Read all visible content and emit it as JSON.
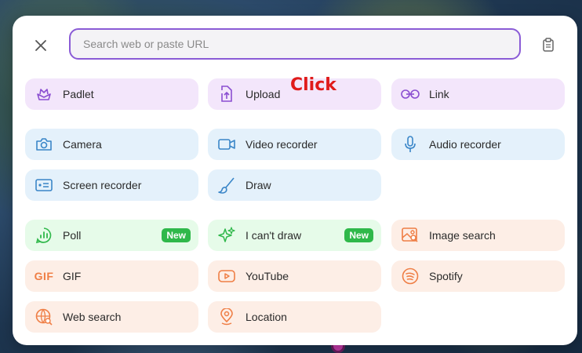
{
  "search": {
    "placeholder": "Search web or paste URL"
  },
  "annotation": "Click",
  "colors": {
    "accent": "#8a5bd6",
    "purple_icon": "#8b4fd1",
    "blue_icon": "#3a86c8",
    "green_icon": "#2fb84a",
    "orange_icon": "#ef7e45"
  },
  "tiles": [
    {
      "label": "Padlet",
      "icon": "padlet-icon"
    },
    {
      "label": "Upload",
      "icon": "upload-icon"
    },
    {
      "label": "Link",
      "icon": "link-icon"
    },
    {
      "label": "Camera",
      "icon": "camera-icon"
    },
    {
      "label": "Video recorder",
      "icon": "video-icon"
    },
    {
      "label": "Audio recorder",
      "icon": "microphone-icon"
    },
    {
      "label": "Screen recorder",
      "icon": "screen-recorder-icon"
    },
    {
      "label": "Draw",
      "icon": "brush-icon"
    },
    {
      "label": "Poll",
      "icon": "poll-icon",
      "badge": "New"
    },
    {
      "label": "I can't draw",
      "icon": "sparkle-icon",
      "badge": "New"
    },
    {
      "label": "Image search",
      "icon": "image-search-icon"
    },
    {
      "label": "GIF",
      "icon": "gif-icon",
      "icon_text": "GIF"
    },
    {
      "label": "YouTube",
      "icon": "youtube-icon"
    },
    {
      "label": "Spotify",
      "icon": "spotify-icon"
    },
    {
      "label": "Web search",
      "icon": "globe-icon"
    },
    {
      "label": "Location",
      "icon": "location-pin-icon"
    }
  ]
}
